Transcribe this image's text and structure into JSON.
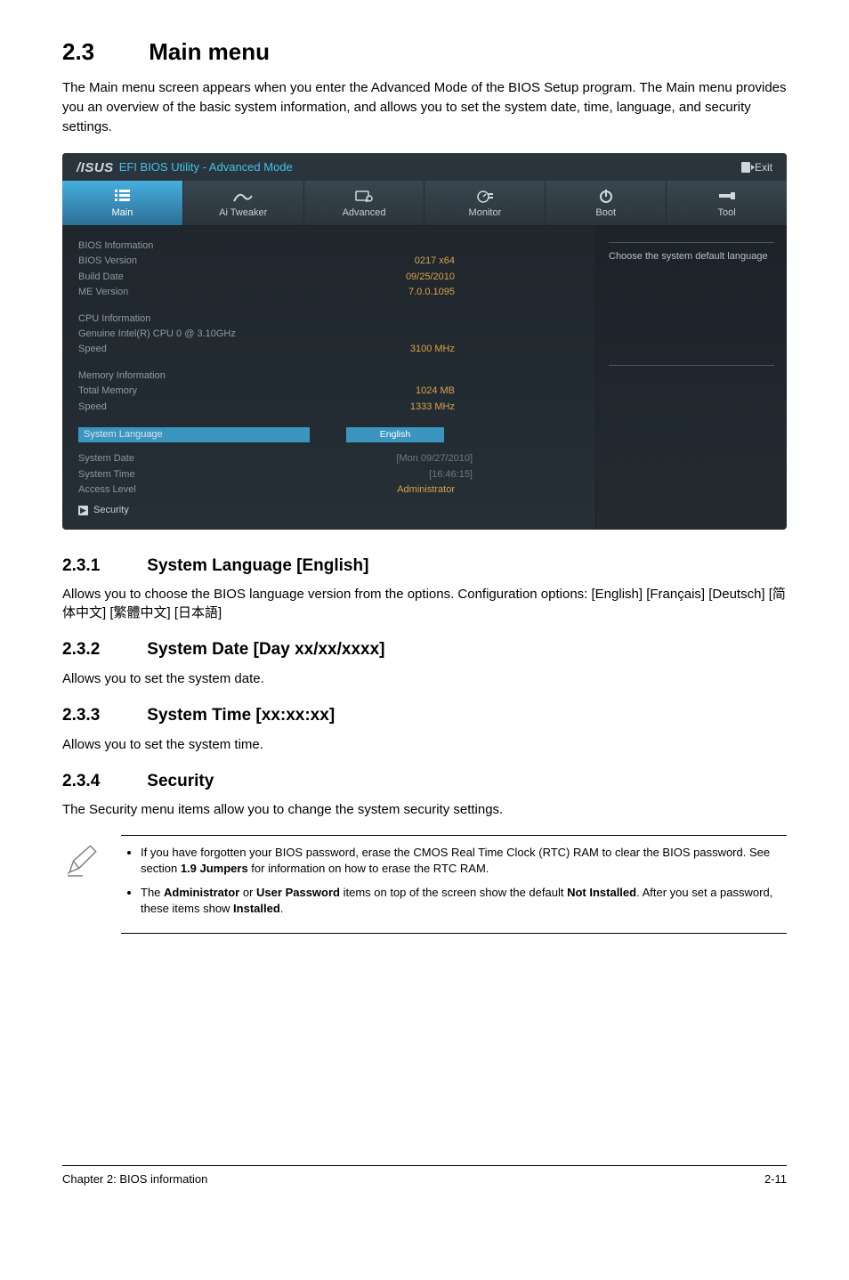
{
  "section": {
    "num": "2.3",
    "title": "Main menu"
  },
  "intro": "The Main menu screen appears when you enter the Advanced Mode of the BIOS Setup program. The Main menu provides you an overview of the basic system information, and allows you to set the system date, time, language, and security settings.",
  "bios": {
    "brand_sub": "EFI BIOS Utility - Advanced Mode",
    "exit": "Exit",
    "tabs": {
      "main": "Main",
      "ai": "Ai  Tweaker",
      "adv": "Advanced",
      "mon": "Monitor",
      "boot": "Boot",
      "tool": "Tool"
    },
    "side_help": "Choose the system default language",
    "blocks": {
      "bios_info_h": "BIOS Information",
      "bios_version_l": "BIOS Version",
      "bios_version_v": "0217 x64",
      "build_l": "Build Date",
      "build_v": "09/25/2010",
      "me_l": "ME Version",
      "me_v": "7.0.0.1095",
      "cpu_h": "CPU Information",
      "cpu_model": "Genuine Intel(R) CPU 0 @ 3.10GHz",
      "cpu_speed_l": "Speed",
      "cpu_speed_v": "3100 MHz",
      "mem_h": "Memory Information",
      "mem_total_l": "Total Memory",
      "mem_total_v": "1024 MB",
      "mem_speed_l": "Speed",
      "mem_speed_v": "1333 MHz",
      "lang_l": "System Language",
      "lang_v": "English",
      "date_l": "System Date",
      "date_v": "[Mon 09/27/2010]",
      "time_l": "System Time",
      "time_v": "[16:46:15]",
      "access_l": "Access Level",
      "access_v": "Administrator",
      "security": "Security"
    }
  },
  "s231": {
    "num": "2.3.1",
    "title": "System Language [English]",
    "body1": "Allows you to choose the BIOS language version from the options. Configuration options: [English] [Français] [Deutsch] [简体中文] [繁體中文] [日本語]"
  },
  "s232": {
    "num": "2.3.2",
    "title": "System Date [Day xx/xx/xxxx]",
    "body": "Allows you to set the system date."
  },
  "s233": {
    "num": "2.3.3",
    "title": "System Time [xx:xx:xx]",
    "body": "Allows you to set the system time."
  },
  "s234": {
    "num": "2.3.4",
    "title": "Security",
    "body": "The Security menu items allow you to change the system security settings."
  },
  "notes": {
    "n1a": "If you have forgotten your BIOS password, erase the CMOS Real Time Clock (RTC) RAM to clear the BIOS password. See section ",
    "n1b": "1.9 Jumpers",
    "n1c": " for information on how to erase the RTC RAM.",
    "n2a": "The ",
    "n2b": "Administrator",
    "n2c": " or ",
    "n2d": "User Password",
    "n2e": " items on top of the screen show the default ",
    "n2f": "Not Installed",
    "n2g": ". After you set a password, these items show ",
    "n2h": "Installed",
    "n2i": "."
  },
  "footer": {
    "left": "Chapter 2: BIOS information",
    "right": "2-11"
  }
}
